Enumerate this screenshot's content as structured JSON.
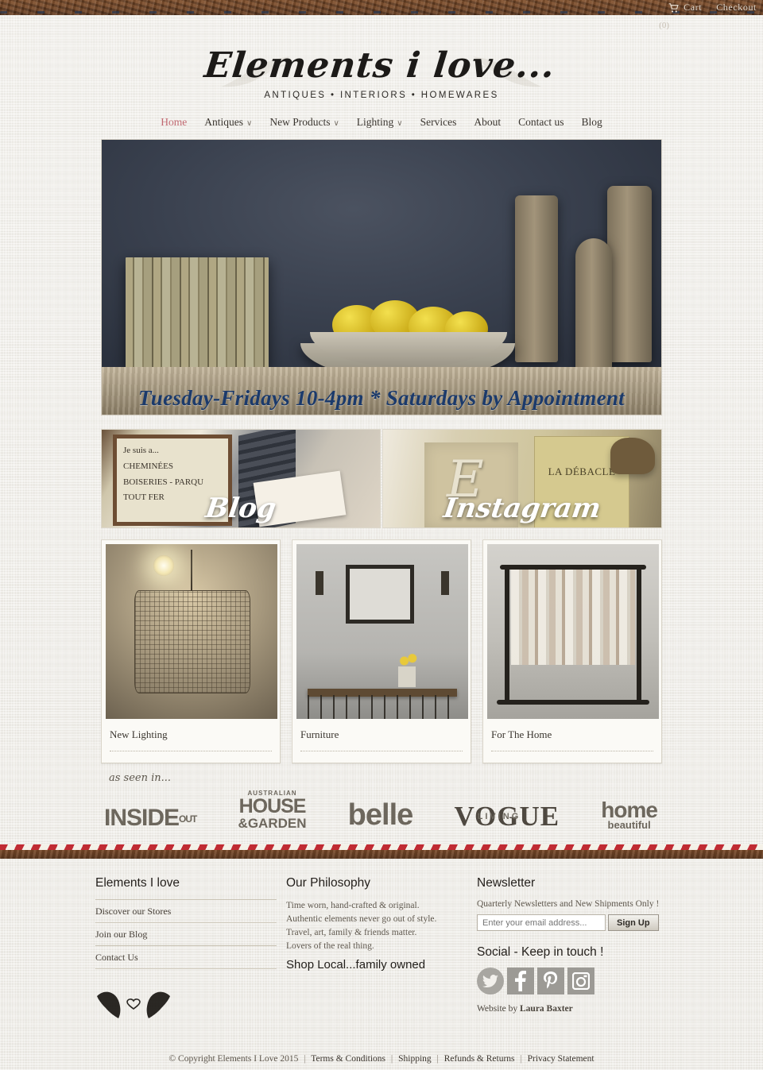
{
  "topbar": {
    "cart_label": "Cart",
    "cart_count": "(0)",
    "checkout_label": "Checkout",
    "cart_icon": "shopping-cart-icon"
  },
  "logo": {
    "script": "Elements i love...",
    "tagline": "ANTIQUES • INTERIORS • HOMEWARES",
    "wing_icon": "angel-wing-icon"
  },
  "nav": {
    "items": [
      {
        "label": "Home",
        "caret": "",
        "active": true
      },
      {
        "label": "Antiques",
        "caret": "∨",
        "active": false
      },
      {
        "label": "New Products",
        "caret": "∨",
        "active": false
      },
      {
        "label": "Lighting",
        "caret": "∨",
        "active": false
      },
      {
        "label": "Services",
        "caret": "",
        "active": false
      },
      {
        "label": "About",
        "caret": "",
        "active": false
      },
      {
        "label": "Contact us",
        "caret": "",
        "active": false
      },
      {
        "label": "Blog",
        "caret": "",
        "active": false
      }
    ]
  },
  "hero": {
    "caption": "Tuesday-Fridays 10-4pm * Saturdays by Appointment",
    "alt": "Lemons in a stone bowl with antique books and wooden candlesticks"
  },
  "banners": [
    {
      "label": "Blog",
      "name": "blog-banner",
      "poster_line1": "Je suis a...",
      "poster_line2": "CHEMINÉES",
      "poster_line3": "BOISERIES - PARQU",
      "poster_line4": "TOUT FER"
    },
    {
      "label": "Instagram",
      "name": "instagram-banner",
      "book_title": "LA DÉBACLE",
      "bag_letter": "E"
    }
  ],
  "cards": [
    {
      "label": "New Lighting",
      "name": "card-new-lighting"
    },
    {
      "label": "Furniture",
      "name": "card-furniture"
    },
    {
      "label": "For The Home",
      "name": "card-for-the-home"
    }
  ],
  "asseen": {
    "label": "as seen in...",
    "magazines": [
      {
        "name": "inside-out",
        "main": "INSIDE",
        "sub": "OUT"
      },
      {
        "name": "house-garden",
        "top": "AUSTRALIAN",
        "main": "HOUSE",
        "sub": "&GARDEN"
      },
      {
        "name": "belle",
        "main": "belle"
      },
      {
        "name": "vogue-living",
        "main": "VOGUE",
        "sub": "LIVING"
      },
      {
        "name": "home-beautiful",
        "main": "home",
        "sub": "beautiful"
      }
    ]
  },
  "footer": {
    "col1": {
      "heading": "Elements I love",
      "links": [
        "Discover our Stores",
        "Join our Blog",
        "Contact Us"
      ],
      "wing_icon": "winged-heart-icon"
    },
    "col2": {
      "heading": "Our Philosophy",
      "lines": [
        "Time worn, hand-crafted & original.",
        "Authentic elements never go out of style.",
        "Travel, art, family & friends matter.",
        "Lovers of the real thing."
      ],
      "strong": "Shop Local...family owned"
    },
    "col3": {
      "heading": "Newsletter",
      "subtext": "Quarterly Newsletters and New Shipments Only !",
      "email_placeholder": "Enter your email address...",
      "email_value": "",
      "signup_label": "Sign Up",
      "social_heading": "Social - Keep in touch !",
      "socials": [
        {
          "name": "twitter-icon",
          "glyph": "t"
        },
        {
          "name": "facebook-icon",
          "glyph": "f"
        },
        {
          "name": "pinterest-icon",
          "glyph": "P"
        },
        {
          "name": "instagram-icon",
          "glyph": "◉"
        }
      ],
      "credit_prefix": "Website by ",
      "credit_name": "Laura Baxter"
    }
  },
  "copyright": {
    "text": "© Copyright Elements I Love 2015",
    "links": [
      "Terms & Conditions",
      "Shipping",
      "Refunds & Returns",
      "Privacy Statement"
    ],
    "separator": "|"
  },
  "colors": {
    "accent": "#c16a72",
    "leather": "#6e4426",
    "hero_caption": "#1b3a6b",
    "ribbon_red": "#c02b33",
    "page_bg": "#efece4"
  }
}
